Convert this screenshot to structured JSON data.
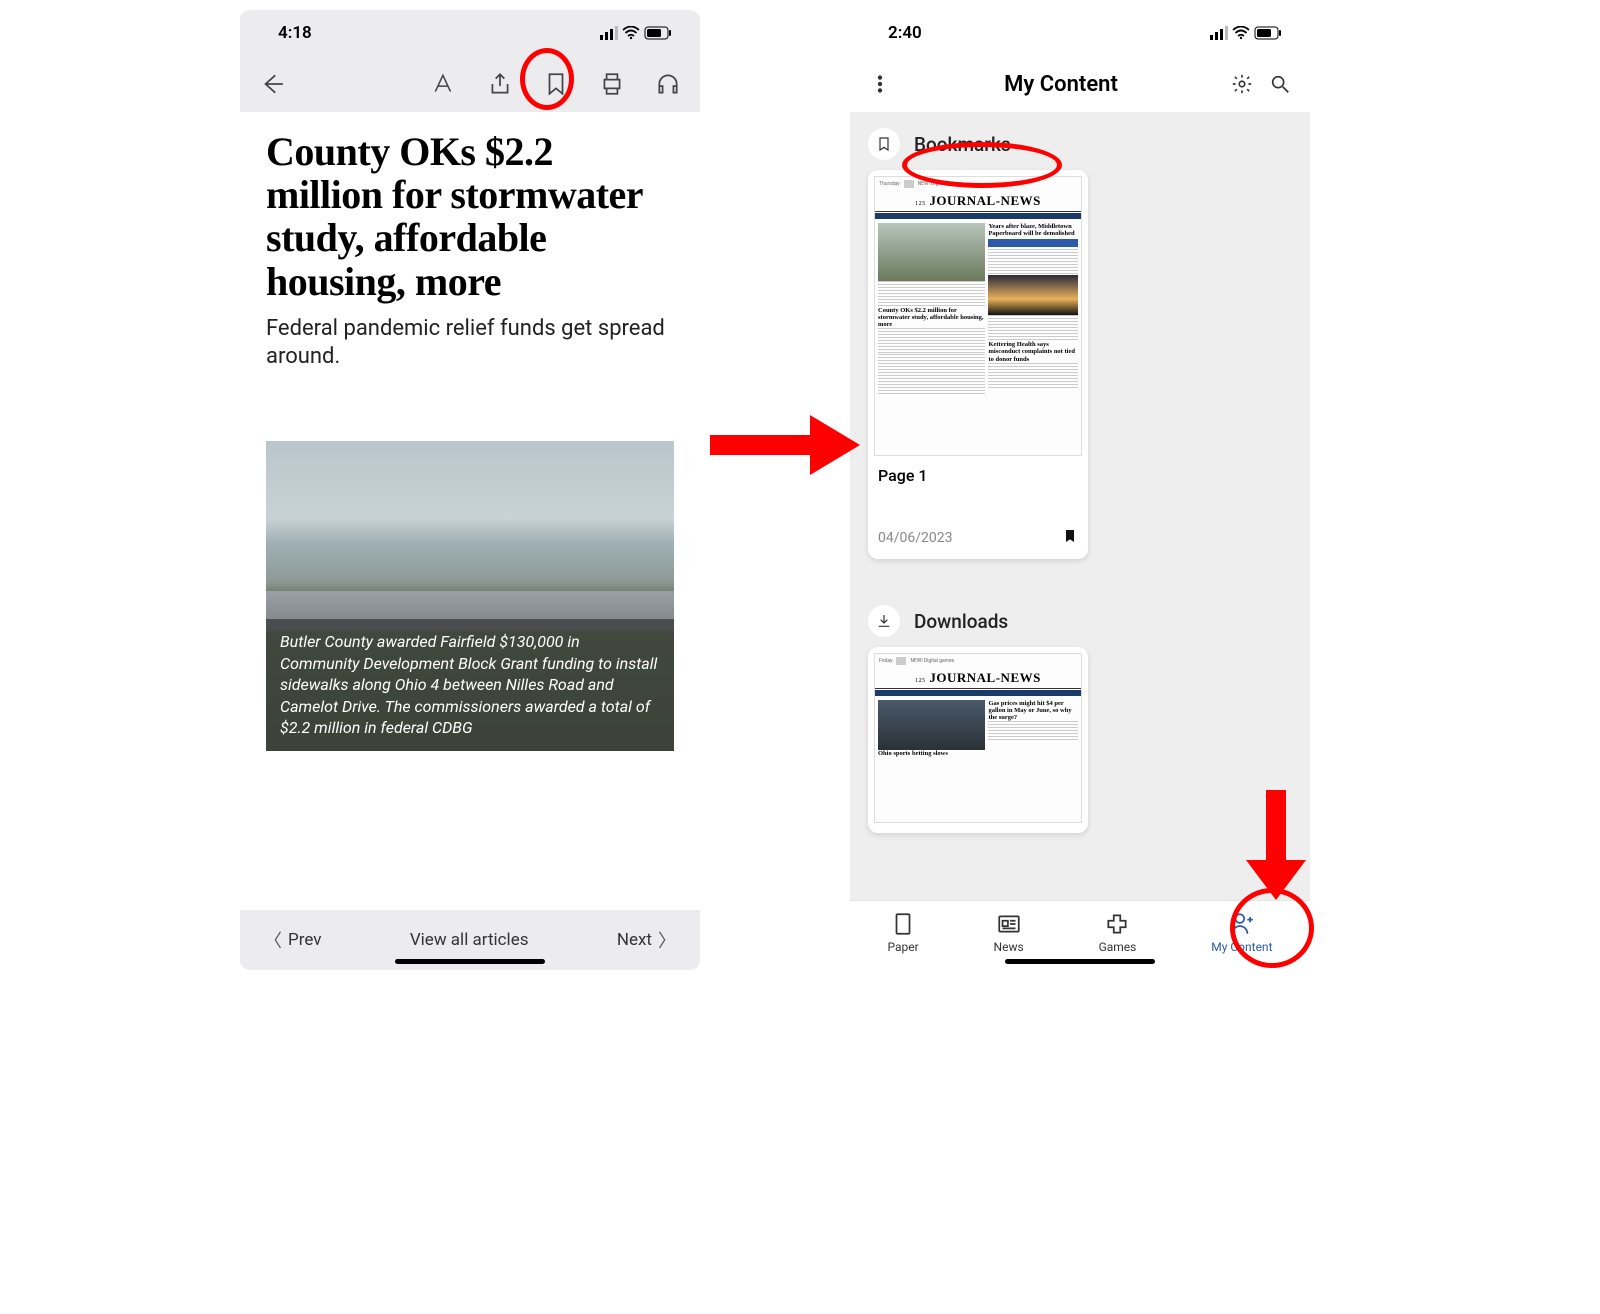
{
  "left": {
    "status": {
      "time": "4:18"
    },
    "toolbar_icons": [
      "back",
      "text-size",
      "share",
      "bookmark",
      "print",
      "listen"
    ],
    "article": {
      "headline": "County OKs $2.2 million for stormwater study, affordable housing, more",
      "subhead": "Federal pandemic relief funds get spread around.",
      "photo_caption": "Butler County awarded Fairfield $130,000 in Community Development Block Grant funding to install sidewalks along Ohio 4 between Nilles Road and Camelot Drive. The commissioners awarded a total of $2.2 million in federal CDBG"
    },
    "footer": {
      "prev": "Prev",
      "all": "View all articles",
      "next": "Next"
    }
  },
  "right": {
    "status": {
      "time": "2:40"
    },
    "header": {
      "title": "My Content"
    },
    "sections": {
      "bookmarks": {
        "label": "Bookmarks",
        "card": {
          "masthead": "JOURNAL-NEWS",
          "masthead_prefix": "125",
          "story_a": "Years after blaze, Middletown Paperboard will be demolished",
          "story_b": "County OKs $2.2 million for stormwater study, affordable housing, more",
          "story_c": "Kettering Health says misconduct complaints not tied to donor funds",
          "page_label": "Page 1",
          "date": "04/06/2023"
        }
      },
      "downloads": {
        "label": "Downloads",
        "card": {
          "masthead": "JOURNAL-NEWS",
          "masthead_prefix": "125",
          "story_a": "Gas prices might hit $4 per gallon in May or June, so why the surge?",
          "story_b": "Ohio sports betting slows"
        }
      }
    },
    "tabs": {
      "paper": "Paper",
      "news": "News",
      "games": "Games",
      "mycontent": "My Content"
    }
  }
}
